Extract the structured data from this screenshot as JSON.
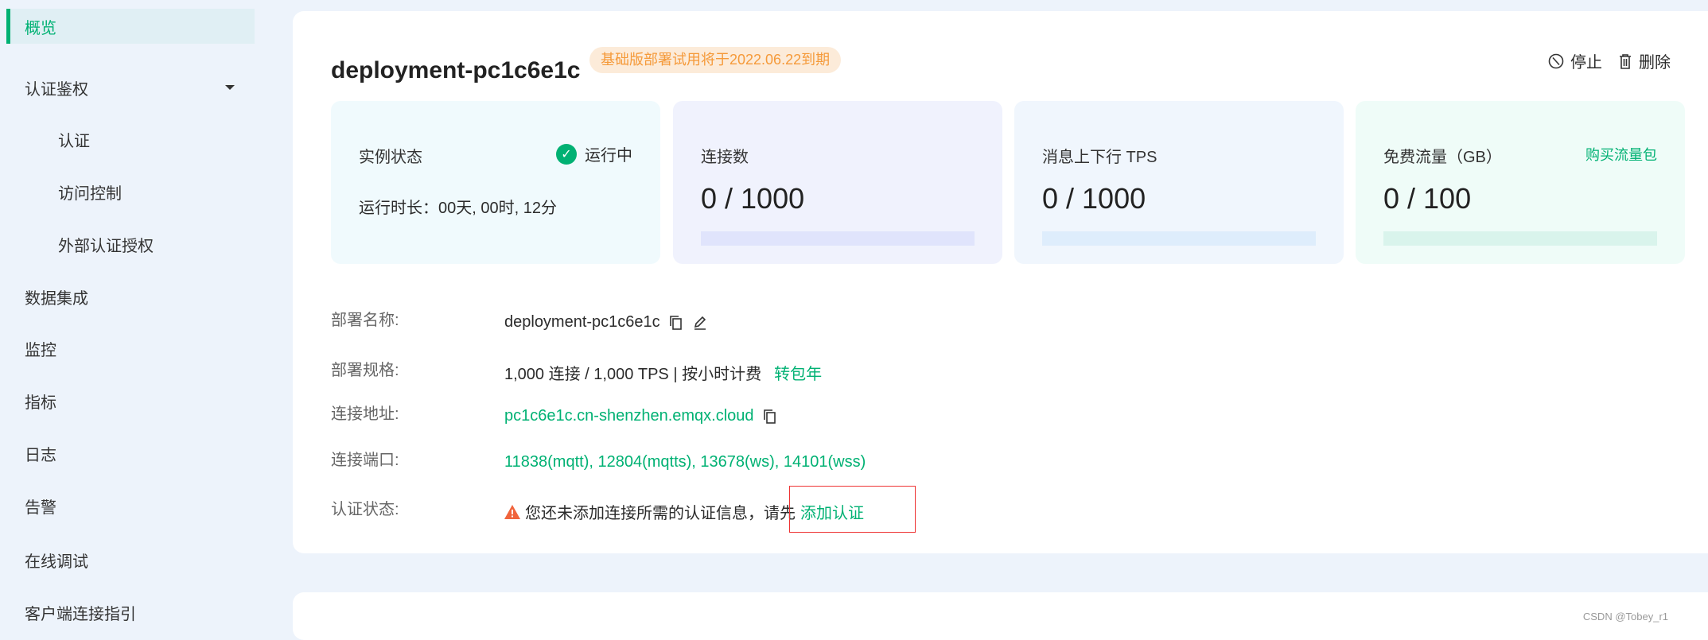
{
  "sidebar": {
    "items": [
      {
        "label": "概览",
        "active": true
      },
      {
        "label": "认证鉴权",
        "expanded": true
      },
      {
        "label": "认证"
      },
      {
        "label": "访问控制"
      },
      {
        "label": "外部认证授权"
      },
      {
        "label": "数据集成"
      },
      {
        "label": "监控"
      },
      {
        "label": "指标"
      },
      {
        "label": "日志"
      },
      {
        "label": "告警"
      },
      {
        "label": "在线调试"
      },
      {
        "label": "客户端连接指引"
      }
    ]
  },
  "header": {
    "title": "deployment-pc1c6e1c",
    "badge": "基础版部署试用将于2022.06.22到期",
    "stop_label": "停止",
    "delete_label": "删除"
  },
  "stats": {
    "status": {
      "label": "实例状态",
      "value": "运行中",
      "uptime": "运行时长：00天, 00时, 12分"
    },
    "connections": {
      "label": "连接数",
      "value": "0 / 1000",
      "fill": 0
    },
    "tps": {
      "label": "消息上下行 TPS",
      "value": "0 / 1000",
      "fill": 0
    },
    "traffic": {
      "label": "免费流量（GB）",
      "value": "0 / 100",
      "fill": 0,
      "action": "购买流量包"
    }
  },
  "details": {
    "name": {
      "label": "部署名称:",
      "value": "deployment-pc1c6e1c"
    },
    "spec": {
      "label": "部署规格:",
      "value": "1,000 连接 / 1,000 TPS | 按小时计费",
      "action": "转包年"
    },
    "address": {
      "label": "连接地址:",
      "value": "pc1c6e1c.cn-shenzhen.emqx.cloud"
    },
    "ports": {
      "label": "连接端口:",
      "value": "11838(mqtt), 12804(mqtts), 13678(ws), 14101(wss)"
    },
    "auth": {
      "label": "认证状态:",
      "warning": "您还未添加连接所需的认证信息，请先",
      "action": "添加认证"
    }
  },
  "watermark": "CSDN @Tobey_r1",
  "colors": {
    "accent": "#00b173",
    "warning": "#f0643c",
    "badge_text": "#f59a3a"
  }
}
